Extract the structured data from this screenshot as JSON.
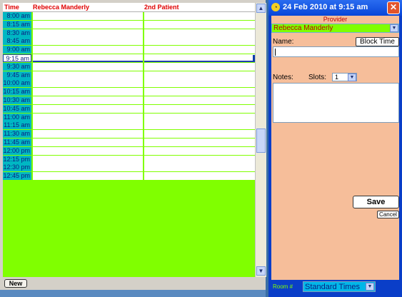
{
  "grid": {
    "headers": [
      "Time",
      "Rebecca Manderly",
      "2nd Patient"
    ],
    "times": [
      "8:00 am",
      "8:15 am",
      "8:30 am",
      "8:45 am",
      "9:00 am",
      "9:15 am",
      "9:30 am",
      "9:45 am",
      "10:00 am",
      "10:15 am",
      "10:30 am",
      "10:45 am",
      "11:00 am",
      "11:15 am",
      "11:30 am",
      "11:45 am",
      "12:00 pm",
      "12:15 pm",
      "12:30 pm",
      "12:45 pm"
    ],
    "selected_time": "9:15 am",
    "new_label": "New"
  },
  "scroll": {
    "up_icon": "chevron-up-icon",
    "down_icon": "chevron-down-icon"
  },
  "dialog": {
    "title": "24 Feb 2010 at  9:15 am",
    "provider_label": "Provider",
    "provider_value": "Rebecca Manderly",
    "name_label": "Name:",
    "name_value": "",
    "block_time_label": "Block Time",
    "notes_label": "Notes:",
    "slots_label": "Slots:",
    "slots_value": "1",
    "notes_value": "",
    "save_label": "Save",
    "cancel_label": "Cancel",
    "room_label": "Room #",
    "room_value": "Standard Times",
    "close_glyph": "✕"
  },
  "colors": {
    "grid_bg": "#80ff00",
    "time_cell": "#00b7c3",
    "header_text": "#e00000",
    "panel_bg": "#f6be9a",
    "title_bar": "#0846d8"
  }
}
